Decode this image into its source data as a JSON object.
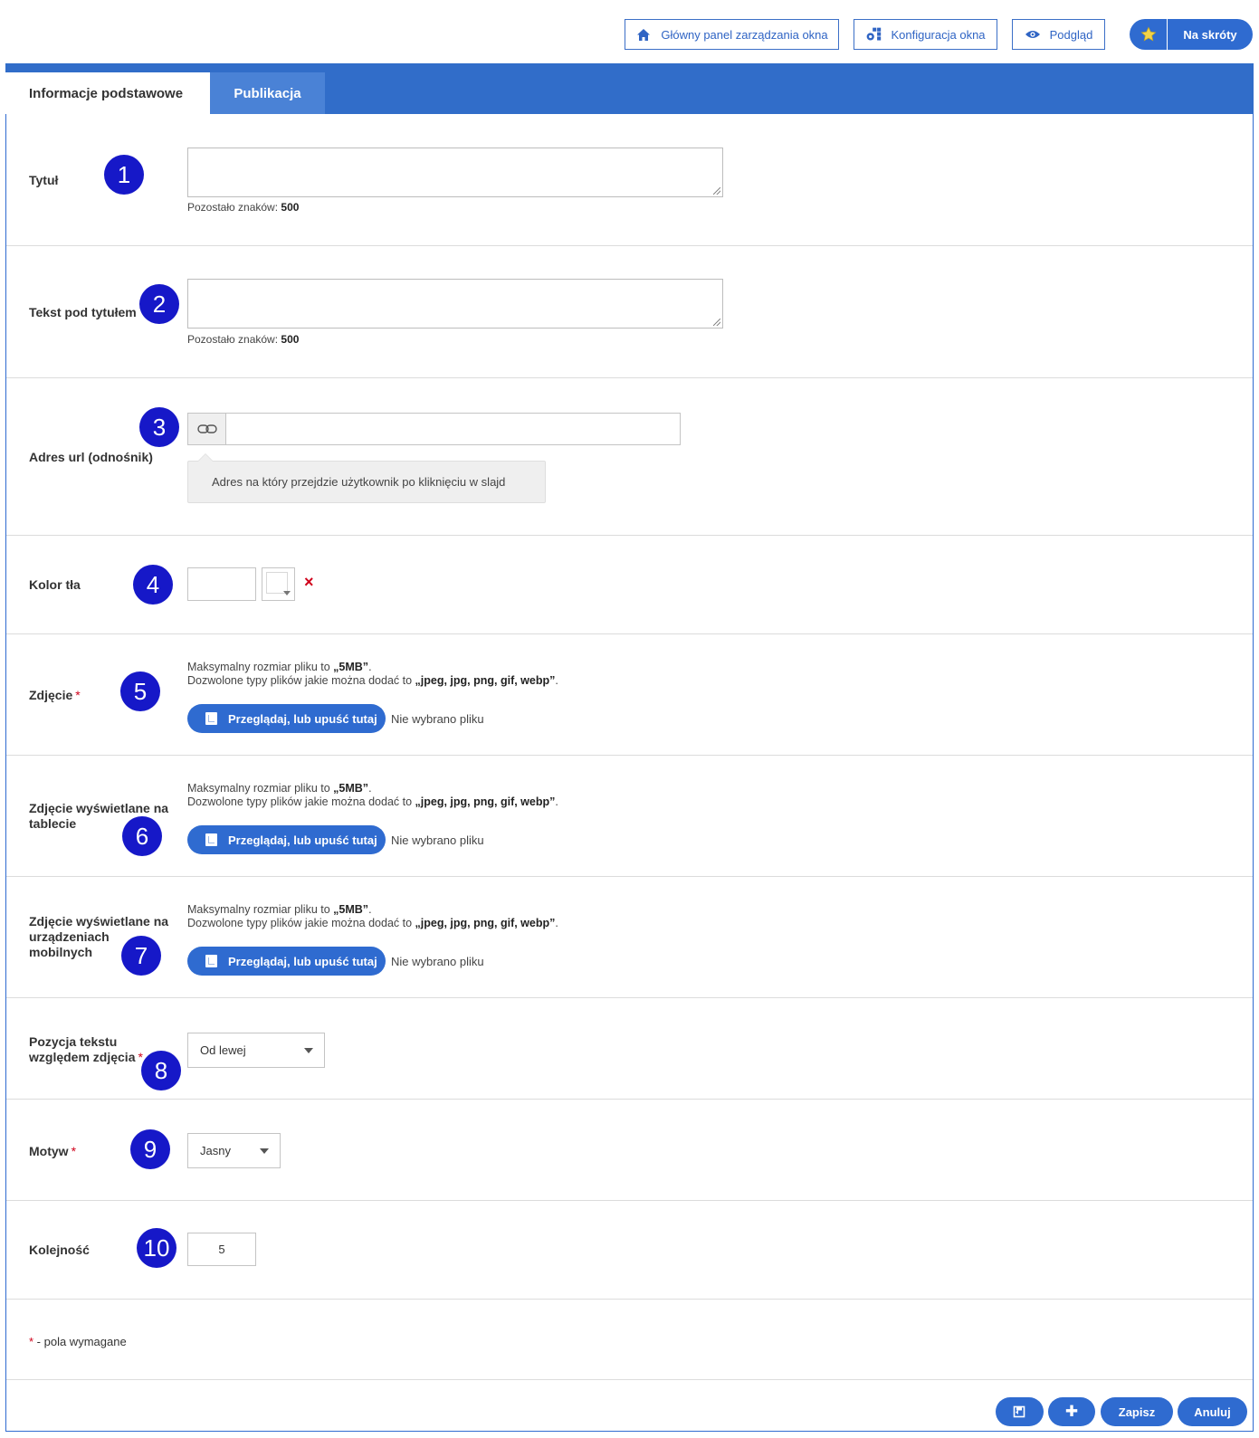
{
  "toolbar": {
    "main_panel": "Główny panel zarządzania okna",
    "config": "Konfiguracja okna",
    "preview": "Podgląd",
    "shortcuts": "Na skróty"
  },
  "tabs": [
    {
      "label": "Informacje podstawowe",
      "active": true
    },
    {
      "label": "Publikacja",
      "active": false
    }
  ],
  "fields": {
    "title": {
      "label": "Tytuł",
      "badge": "1",
      "value": "",
      "counter_label": "Pozostało znaków:",
      "counter_value": "500"
    },
    "subtitle": {
      "label": "Tekst pod tytułem",
      "badge": "2",
      "value": "",
      "counter_label": "Pozostało znaków:",
      "counter_value": "500"
    },
    "url": {
      "label": "Adres url (odnośnik)",
      "badge": "3",
      "value": "",
      "hint": "Adres na który przejdzie użytkownik po kliknięciu w slajd"
    },
    "bg_color": {
      "label": "Kolor tła",
      "badge": "4",
      "value": "",
      "clear_icon": "×"
    },
    "photo": {
      "label": "Zdjęcie",
      "required": "*",
      "badge": "5"
    },
    "photo_tablet": {
      "label": "Zdjęcie wyświetlane na tablecie",
      "badge": "6"
    },
    "photo_mobile": {
      "label": "Zdjęcie wyświetlane na urządzeniach mobilnych",
      "badge": "7"
    },
    "text_position": {
      "label": "Pozycja tekstu względem zdjęcia",
      "required": "*",
      "badge": "8",
      "value": "Od lewej"
    },
    "theme": {
      "label": "Motyw",
      "required": "*",
      "badge": "9",
      "value": "Jasny"
    },
    "order": {
      "label": "Kolejność",
      "badge": "10",
      "value": "5"
    }
  },
  "upload": {
    "max_size_prefix": "Maksymalny rozmiar pliku to ",
    "max_size": "„5MB”",
    "max_size_suffix": ".",
    "types_prefix": "Dozwolone typy plików jakie można dodać to ",
    "types": "„jpeg, jpg, png, gif, webp”",
    "types_suffix": ".",
    "button": "Przeglądaj, lub upuść tutaj",
    "no_file": "Nie wybrano pliku"
  },
  "required_note": {
    "star": "*",
    "text": " - pola wymagane"
  },
  "footer": {
    "save": "Zapisz",
    "cancel": "Anuluj",
    "add_icon": "✚"
  },
  "colors": {
    "accent": "#2f6bd0",
    "badge": "#1618c8",
    "required": "#d0021b"
  }
}
